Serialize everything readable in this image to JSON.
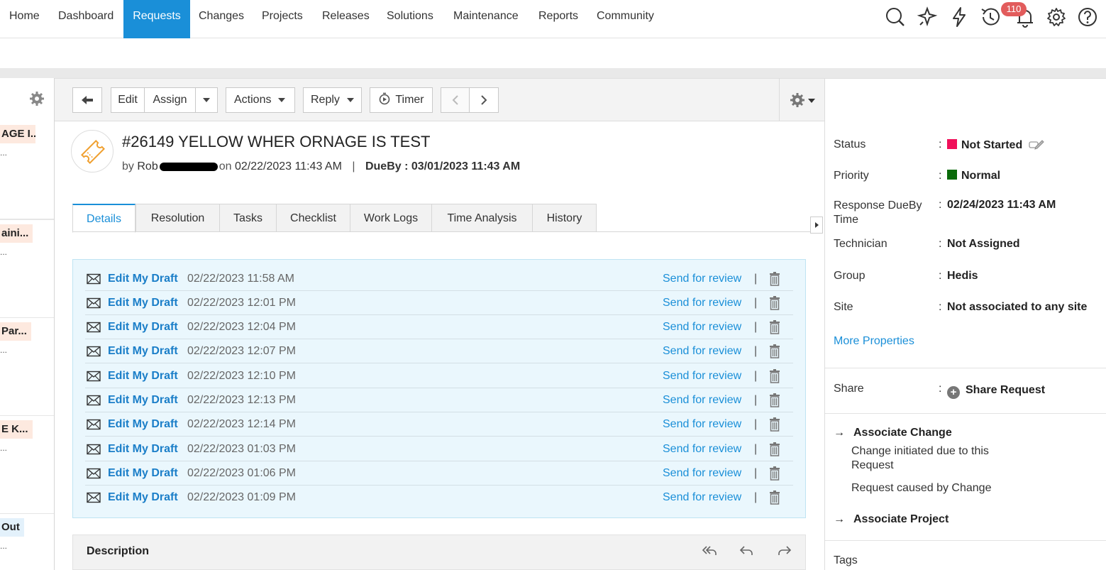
{
  "nav": {
    "items": [
      "Home",
      "Dashboard",
      "Requests",
      "Changes",
      "Projects",
      "Releases",
      "Solutions",
      "Maintenance",
      "Reports",
      "Community"
    ],
    "active": "Requests",
    "notification_count": "110",
    "icons": [
      "search-icon",
      "magic-icon",
      "bolt-icon",
      "history-icon",
      "bell-icon",
      "gear-icon",
      "help-icon"
    ]
  },
  "left_list": {
    "items": [
      {
        "title": "AGE I...",
        "sub": "..."
      },
      {
        "title": "aini...",
        "sub": "..."
      },
      {
        "title": "Par...",
        "sub": "..."
      },
      {
        "title": "E K...",
        "sub": "..."
      },
      {
        "title": "Out",
        "sub": "..."
      }
    ]
  },
  "toolbar": {
    "edit": "Edit",
    "assign": "Assign",
    "actions": "Actions",
    "reply": "Reply",
    "timer": "Timer"
  },
  "ticket": {
    "title": "#26149  YELLOW WHER ORNAGE IS TEST",
    "by": "by",
    "requester": "Rob",
    "on": "on",
    "created": "02/22/2023 11:43 AM",
    "divider": "|",
    "dueby_label": "DueBy :",
    "dueby": "03/01/2023 11:43 AM"
  },
  "tabs": [
    "Details",
    "Resolution",
    "Tasks",
    "Checklist",
    "Work Logs",
    "Time Analysis",
    "History"
  ],
  "drafts": {
    "link_label": "Edit My Draft",
    "review_label": "Send for review",
    "separator": "|",
    "times": [
      "02/22/2023 11:58 AM",
      "02/22/2023 12:01 PM",
      "02/22/2023 12:04 PM",
      "02/22/2023 12:07 PM",
      "02/22/2023 12:10 PM",
      "02/22/2023 12:13 PM",
      "02/22/2023 12:14 PM",
      "02/22/2023 01:03 PM",
      "02/22/2023 01:06 PM",
      "02/22/2023 01:09 PM"
    ]
  },
  "description": {
    "title": "Description"
  },
  "properties": {
    "colon": ":",
    "status_label": "Status",
    "status": "Not Started",
    "status_color": "#f0105a",
    "priority_label": "Priority",
    "priority": "Normal",
    "priority_color": "#0a6b0a",
    "response_label_1": "Response DueBy",
    "response_label_2": "Time",
    "response": "02/24/2023 11:43 AM",
    "technician_label": "Technician",
    "technician": "Not Assigned",
    "group_label": "Group",
    "group": "Hedis",
    "site_label": "Site",
    "site": "Not associated to any site",
    "more": "More Properties",
    "share_label": "Share",
    "share": "Share Request",
    "assoc_change": "Associate Change",
    "change_initiated_1": "Change initiated due to this",
    "change_initiated_2": "Request",
    "caused_by": "Request caused by Change",
    "assoc_project": "Associate Project",
    "tags_label": "Tags"
  },
  "colors": {
    "accent": "#1a8fd8",
    "draft_bg": "#eaf7fd"
  }
}
